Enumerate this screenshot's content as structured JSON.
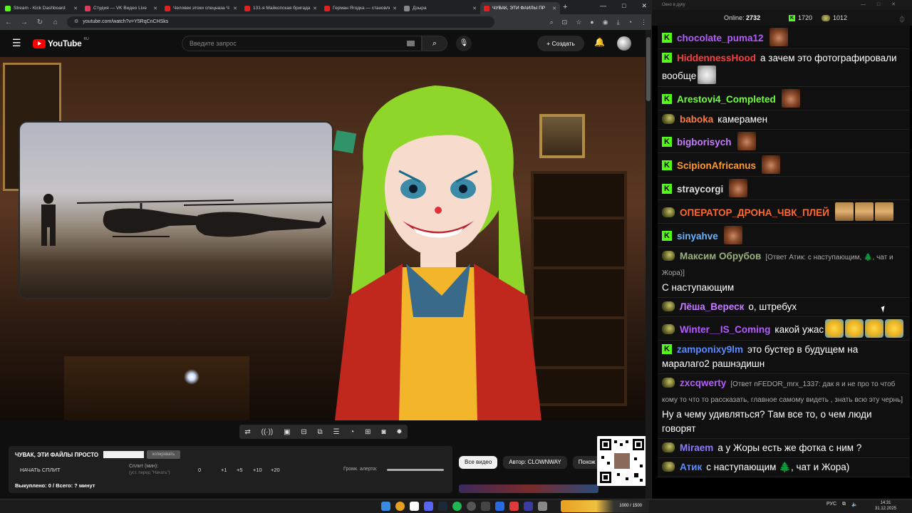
{
  "browser": {
    "tabs": [
      {
        "label": "Stream - Kick Dashboard",
        "color": "#53fc18",
        "active": false
      },
      {
        "label": "Студия — VK Видео Live",
        "color": "#e03a5a",
        "active": false
      },
      {
        "label": "Человек этоки спецназа Ч",
        "color": "#e02020",
        "active": false
      },
      {
        "label": "131-я Майкопская бригада",
        "color": "#e02020",
        "active": false
      },
      {
        "label": "Герман Ягодка — становле",
        "color": "#e02020",
        "active": false
      },
      {
        "label": "Дзыра",
        "color": "#888888",
        "active": false
      },
      {
        "label": "ЧУВАК, ЭТИ ФАЙЛЫ ПР",
        "color": "#e02020",
        "active": true
      }
    ],
    "url": "youtube.com/watch?v=Y5RqCnCHSks"
  },
  "youtube": {
    "logo_text": "YouTube",
    "region": "RU",
    "search_placeholder": "Введите запрос",
    "create_label": "Создать"
  },
  "controls_panel": {
    "title": "ЧУВАК, ЭТИ ФАЙЛЫ ПРОСТО",
    "copy_label": "копировать",
    "start_split": "НАЧАТЬ СПЛИТ",
    "split_label": "Сплит (мин):",
    "split_sub": "(уст. перед \"Начать\")",
    "split_values": [
      "0",
      "+1",
      "+5",
      "+10",
      "+20"
    ],
    "alert_volume_label": "Громк. алерта:",
    "bought_text": "Выкуплено: 0 / Всего: ? минут"
  },
  "chips": [
    "Все видео",
    "Автор: CLOWNWAY",
    "Похож"
  ],
  "chat": {
    "window_title": "Окно в дуку",
    "online_label": "Online:",
    "online_count": "2732",
    "kick_count": "1720",
    "yt_count": "1012",
    "messages": [
      {
        "badge": "k",
        "nick": "chocolate_puma12",
        "color": "#b55cff",
        "text": "",
        "emotes": [
          "face"
        ]
      },
      {
        "badge": "k",
        "nick": "HiddennessHood",
        "color": "#ff3b3b",
        "text": "а зачем это фотографировали вообще",
        "emotes": [
          "cat"
        ]
      },
      {
        "badge": "k",
        "nick": "Arestovi4_Completed",
        "color": "#6cff3c",
        "text": "",
        "emotes": [
          "face"
        ]
      },
      {
        "badge": "y",
        "nick": "baboka",
        "color": "#ff7a3c",
        "text": "камерамен",
        "emotes": []
      },
      {
        "badge": "k",
        "nick": "bigborisych",
        "color": "#c67cff",
        "text": "",
        "emotes": [
          "face"
        ]
      },
      {
        "badge": "k",
        "nick": "ScipionAfricanus",
        "color": "#ff9a2a",
        "text": "",
        "emotes": [
          "face"
        ]
      },
      {
        "badge": "k",
        "nick": "straycorgi",
        "color": "#dddddd",
        "text": "",
        "emotes": [
          "face"
        ]
      },
      {
        "badge": "y",
        "nick": "ОПЕРАТОР_ДРОНА_ЧВК_ПЛЕЙ",
        "color": "#ff6a2a",
        "text": "",
        "emotes": [
          "flag",
          "flag",
          "flag"
        ]
      },
      {
        "badge": "k",
        "nick": "sinyahve",
        "color": "#6ab4ff",
        "text": "",
        "emotes": [
          "face"
        ]
      },
      {
        "badge": "y",
        "nick": "Максим Обрубов",
        "color": "#9ab07a",
        "reply": "[Ответ Атик: с наступающим, 🌲, чат и Жора)]",
        "text": "С наступающим",
        "emotes": []
      },
      {
        "badge": "y",
        "nick": "Лёша_Вереск",
        "color": "#c67cff",
        "text": "о, штребух",
        "emotes": []
      },
      {
        "badge": "y",
        "nick": "Winter__IS_Coming",
        "color": "#b55cff",
        "text": "какой ужас",
        "emotes": [
          "laugh",
          "laugh",
          "laugh",
          "laugh"
        ]
      },
      {
        "badge": "k",
        "nick": "zamponixy9lm",
        "color": "#5a8cff",
        "text": "это бустер в будущем на маралаго2 рашнэдишн",
        "emotes": []
      },
      {
        "badge": "y",
        "nick": "zxcqwerty",
        "color": "#b55cff",
        "reply": "[Ответ nFEDOR_mrx_1337: дак я и не про то чтоб кому то что то рассказать, главное самому видеть , знать всю эту чернь]",
        "text": "Ну а чему удивляться? Там все то, о чем люди говорят",
        "emotes": []
      },
      {
        "badge": "y",
        "nick": "Miraem",
        "color": "#8a7cff",
        "text": "а у Жоры есть же фотка с ним ?",
        "emotes": []
      },
      {
        "badge": "y",
        "nick": "Атик",
        "color": "#5a8cff",
        "text": "с наступающим 🌲, чат и Жора)",
        "emotes": []
      }
    ]
  },
  "taskbar": {
    "promo": "1000 / 1500",
    "lang": "РУС",
    "time": "14:31",
    "date": "31.12.2025"
  },
  "colors": {
    "yt_red": "#ff0000",
    "kick_green": "#53fc18"
  }
}
